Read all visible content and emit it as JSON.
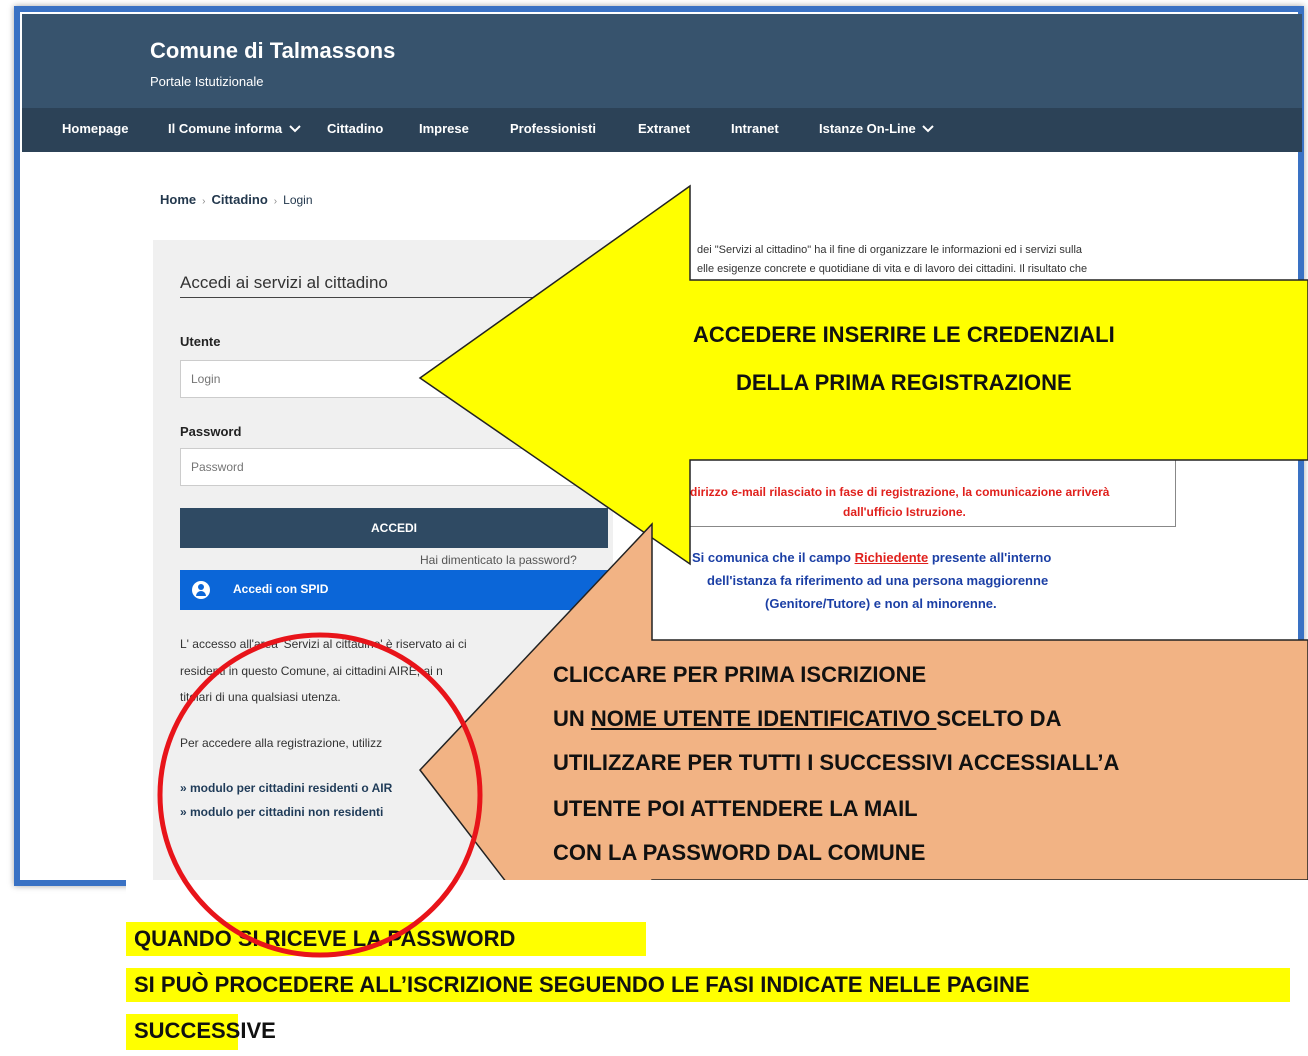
{
  "header": {
    "title": "Comune di Talmassons",
    "subtitle": "Portale Istutizionale"
  },
  "nav": {
    "homepage": "Homepage",
    "comune": "Il Comune informa",
    "cittadino": "Cittadino",
    "imprese": "Imprese",
    "professionisti": "Professionisti",
    "extranet": "Extranet",
    "intranet": "Intranet",
    "istanze": "Istanze On-Line"
  },
  "breadcrumb": {
    "home": "Home",
    "cittadino": "Cittadino",
    "login": "Login",
    "separator": "›"
  },
  "login": {
    "title": "Accedi ai servizi al cittadino",
    "user_label": "Utente",
    "user_placeholder": "Login",
    "password_label": "Password",
    "password_placeholder": "Password",
    "submit_label": "ACCEDI",
    "forgot_label": "Hai dimenticato la password?",
    "spid_label": "Accedi con SPID"
  },
  "info": {
    "line1": "L' accesso all'area 'Servizi al cittadino' è riservato ai ci",
    "line2": "residenti in questo Comune, ai cittadini AIRE, ai n",
    "line3": "titolari di una qualsiasi utenza.",
    "line4": "Per accedere alla registrazione, utilizz",
    "link_residenti": "» modulo per cittadini residenti o AIR",
    "link_non_residenti": "» modulo per cittadini non residenti"
  },
  "right": {
    "intro1": "dei \"Servizi al cittadino\" ha il fine di organizzare le informazioni ed i servizi sulla",
    "intro2": "elle esigenze concrete e quotidiane di vita e di lavoro dei cittadini. Il risultato che",
    "notice1": "dirizzo e-mail rilasciato in fase di registrazione, la comunicazione arriverà",
    "notice2": "dall'ufficio Istruzione.",
    "blue1_pre": "Si comunica che il campo ",
    "blue1_link": "Richiedente",
    "blue1_post": " presente all'interno",
    "blue2": "dell'istanza fa riferimento ad una persona maggiorenne",
    "blue3": "(Genitore/Tutore) e non al minorenne."
  },
  "annotations": {
    "yellow_arrow_1": "ACCEDERE INSERIRE LE CREDENZIALI",
    "yellow_arrow_2": "DELLA PRIMA REGISTRAZIONE",
    "orange_1": "CLICCARE PER PRIMA ISCRIZIONE",
    "orange_2_pre": " UN ",
    "orange_2_underlined": "NOME UTENTE IDENTIFICATIVO ",
    "orange_2_post": "SCELTO DA",
    "orange_3": "UTILIZZARE PER TUTTI I SUCCESSIVI ACCESSIALL’A",
    "orange_4": "UTENTE   POI ATTENDERE LA MAIL",
    "orange_5": "CON LA PASSWORD DAL COMUNE",
    "bottom_1": "QUANDO SI RICEVE LA PASSWORD",
    "bottom_2": "SI PUÒ PROCEDERE ALL’ISCRIZIONE SEGUENDO LE FASI INDICATE NELLE PAGINE",
    "bottom_3": "SUCCESSIVE"
  },
  "colors": {
    "header_bg": "#37536d",
    "nav_bg": "#2c4257",
    "accent_button": "#2f4a63",
    "spid_blue": "#0b66d8",
    "yellow": "#ffff00",
    "orange": "#f2b384",
    "red_circle": "#e8141a"
  },
  "icons": {
    "chevron": "chevron-down-icon",
    "spid": "user-circle-icon"
  }
}
